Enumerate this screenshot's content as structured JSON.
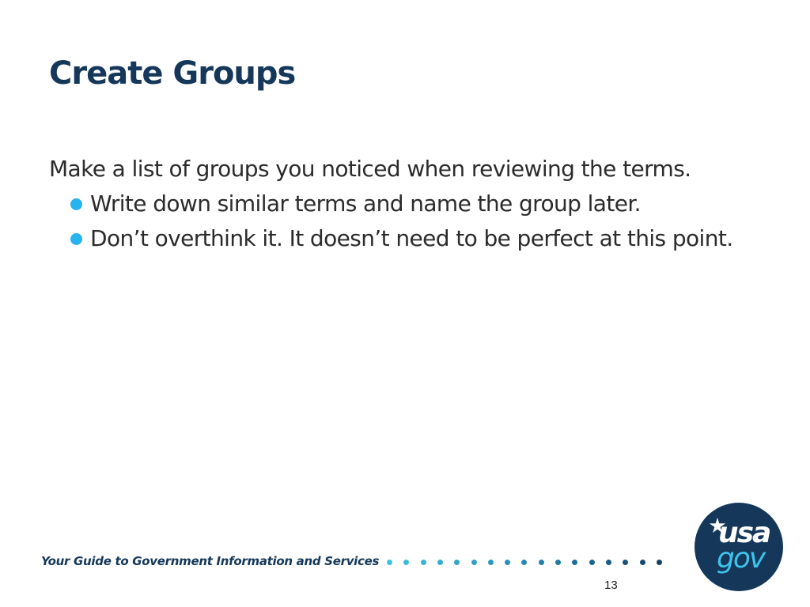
{
  "slide": {
    "title": "Create Groups",
    "intro": "Make a list of groups you noticed when reviewing the terms.",
    "bullets": [
      "Write down similar terms and name the group later.",
      "Don’t overthink it. It doesn’t need to be perfect at this point."
    ],
    "page_number": "13"
  },
  "footer": {
    "tagline": "Your Guide to Government Information and Services",
    "dot_colors": [
      "#3ec3e0",
      "#3bbcdb",
      "#38b5d6",
      "#35aed1",
      "#32a7cc",
      "#2fa0c6",
      "#2c98c0",
      "#2990ba",
      "#2688b3",
      "#2380ab",
      "#2078a3",
      "#1d6f9a",
      "#1a6690",
      "#185d85",
      "#16537a",
      "#154a6e",
      "#144163"
    ],
    "logo": {
      "line1": "usa",
      "line2": "gov",
      "icon": "star-icon"
    }
  },
  "colors": {
    "title": "#14375a",
    "bullet": "#27b2f0",
    "logo_bg": "#14375a",
    "logo_accent": "#3ec3ec"
  }
}
